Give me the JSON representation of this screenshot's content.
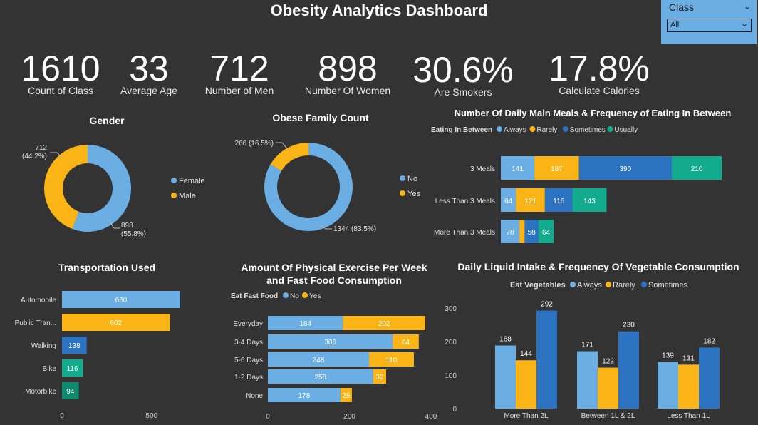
{
  "title": "Obesity Analytics Dashboard",
  "slicer": {
    "label": "Class",
    "value": "All"
  },
  "kpis": [
    {
      "value": "1610",
      "label": "Count of Class"
    },
    {
      "value": "33",
      "label": "Average Age"
    },
    {
      "value": "712",
      "label": "Number of Men"
    },
    {
      "value": "898",
      "label": "Number Of Women"
    },
    {
      "value": "30.6%",
      "label": "Are Smokers"
    },
    {
      "value": "17.8%",
      "label": "Calculate Calories"
    }
  ],
  "colors": {
    "blue_light": "#6aaee3",
    "yellow": "#fbb416",
    "blue_dark": "#2b73c0",
    "teal": "#12ab8e",
    "background": "#333333"
  },
  "chart_data": [
    {
      "type": "pie",
      "title": "Gender",
      "categories": [
        "Female",
        "Male"
      ],
      "values": [
        898,
        712
      ],
      "slice_labels": [
        "898\n(55.8%)",
        "712\n(44.2%)"
      ],
      "colors": [
        "#6aaee3",
        "#fbb416"
      ],
      "legend": "right"
    },
    {
      "type": "pie",
      "title": "Obese Family Count",
      "categories": [
        "No",
        "Yes"
      ],
      "values": [
        1344,
        266
      ],
      "slice_labels": [
        "1344 (83.5%)",
        "266 (16.5%)"
      ],
      "colors": [
        "#6aaee3",
        "#fbb416"
      ],
      "legend": "right"
    },
    {
      "type": "bar",
      "orientation": "horizontal",
      "stacked": true,
      "title": "Number Of Daily Main Meals & Frequency of Eating In Between",
      "legend_title": "Eating In Between",
      "categories": [
        "3 Meals",
        "Less Than 3 Meals",
        "More Than 3 Meals"
      ],
      "series": [
        {
          "name": "Always",
          "values": [
            141,
            64,
            78
          ],
          "color": "#6aaee3"
        },
        {
          "name": "Rarely",
          "values": [
            187,
            121,
            22
          ],
          "color": "#fbb416"
        },
        {
          "name": "Sometimes",
          "values": [
            390,
            116,
            58
          ],
          "color": "#2b73c0"
        },
        {
          "name": "Usually",
          "values": [
            210,
            143,
            64
          ],
          "color": "#12ab8e"
        }
      ],
      "xlim": [
        0,
        1000
      ]
    },
    {
      "type": "bar",
      "orientation": "horizontal",
      "title": "Transportation Used",
      "categories": [
        "Automobile",
        "Public Tran...",
        "Walking",
        "Bike",
        "Motorbike"
      ],
      "values": [
        660,
        602,
        138,
        116,
        94
      ],
      "colors": [
        "#6aaee3",
        "#fbb416",
        "#2b73c0",
        "#12ab8e",
        "#0e8a6e"
      ],
      "x_ticks": [
        "0",
        "500"
      ],
      "xlim": [
        0,
        700
      ]
    },
    {
      "type": "bar",
      "orientation": "horizontal",
      "stacked": true,
      "title": "Amount Of Physical Exercise Per Week and Fast Food Consumption",
      "legend_title": "Eat Fast Food",
      "categories": [
        "Everyday",
        "3-4 Days",
        "5-6 Days",
        "1-2 Days",
        "None"
      ],
      "series": [
        {
          "name": "No",
          "values": [
            184,
            306,
            248,
            258,
            178
          ],
          "color": "#6aaee3"
        },
        {
          "name": "Yes",
          "values": [
            202,
            64,
            110,
            32,
            28
          ],
          "color": "#fbb416"
        }
      ],
      "x_ticks": [
        "0",
        "200",
        "400"
      ],
      "xlim": [
        0,
        400
      ]
    },
    {
      "type": "bar",
      "title": "Daily Liquid Intake & Frequency Of Vegetable Consumption",
      "legend_title": "Eat Vegetables",
      "categories": [
        "More Than 2L",
        "Between 1L & 2L",
        "Less Than 1L"
      ],
      "series": [
        {
          "name": "Always",
          "values": [
            188,
            171,
            139
          ],
          "color": "#6aaee3"
        },
        {
          "name": "Rarely",
          "values": [
            144,
            122,
            131
          ],
          "color": "#fbb416"
        },
        {
          "name": "Sometimes",
          "values": [
            292,
            230,
            182
          ],
          "color": "#2b73c0"
        }
      ],
      "y_ticks": [
        "0",
        "100",
        "200",
        "300"
      ],
      "ylim": [
        0,
        320
      ]
    }
  ]
}
